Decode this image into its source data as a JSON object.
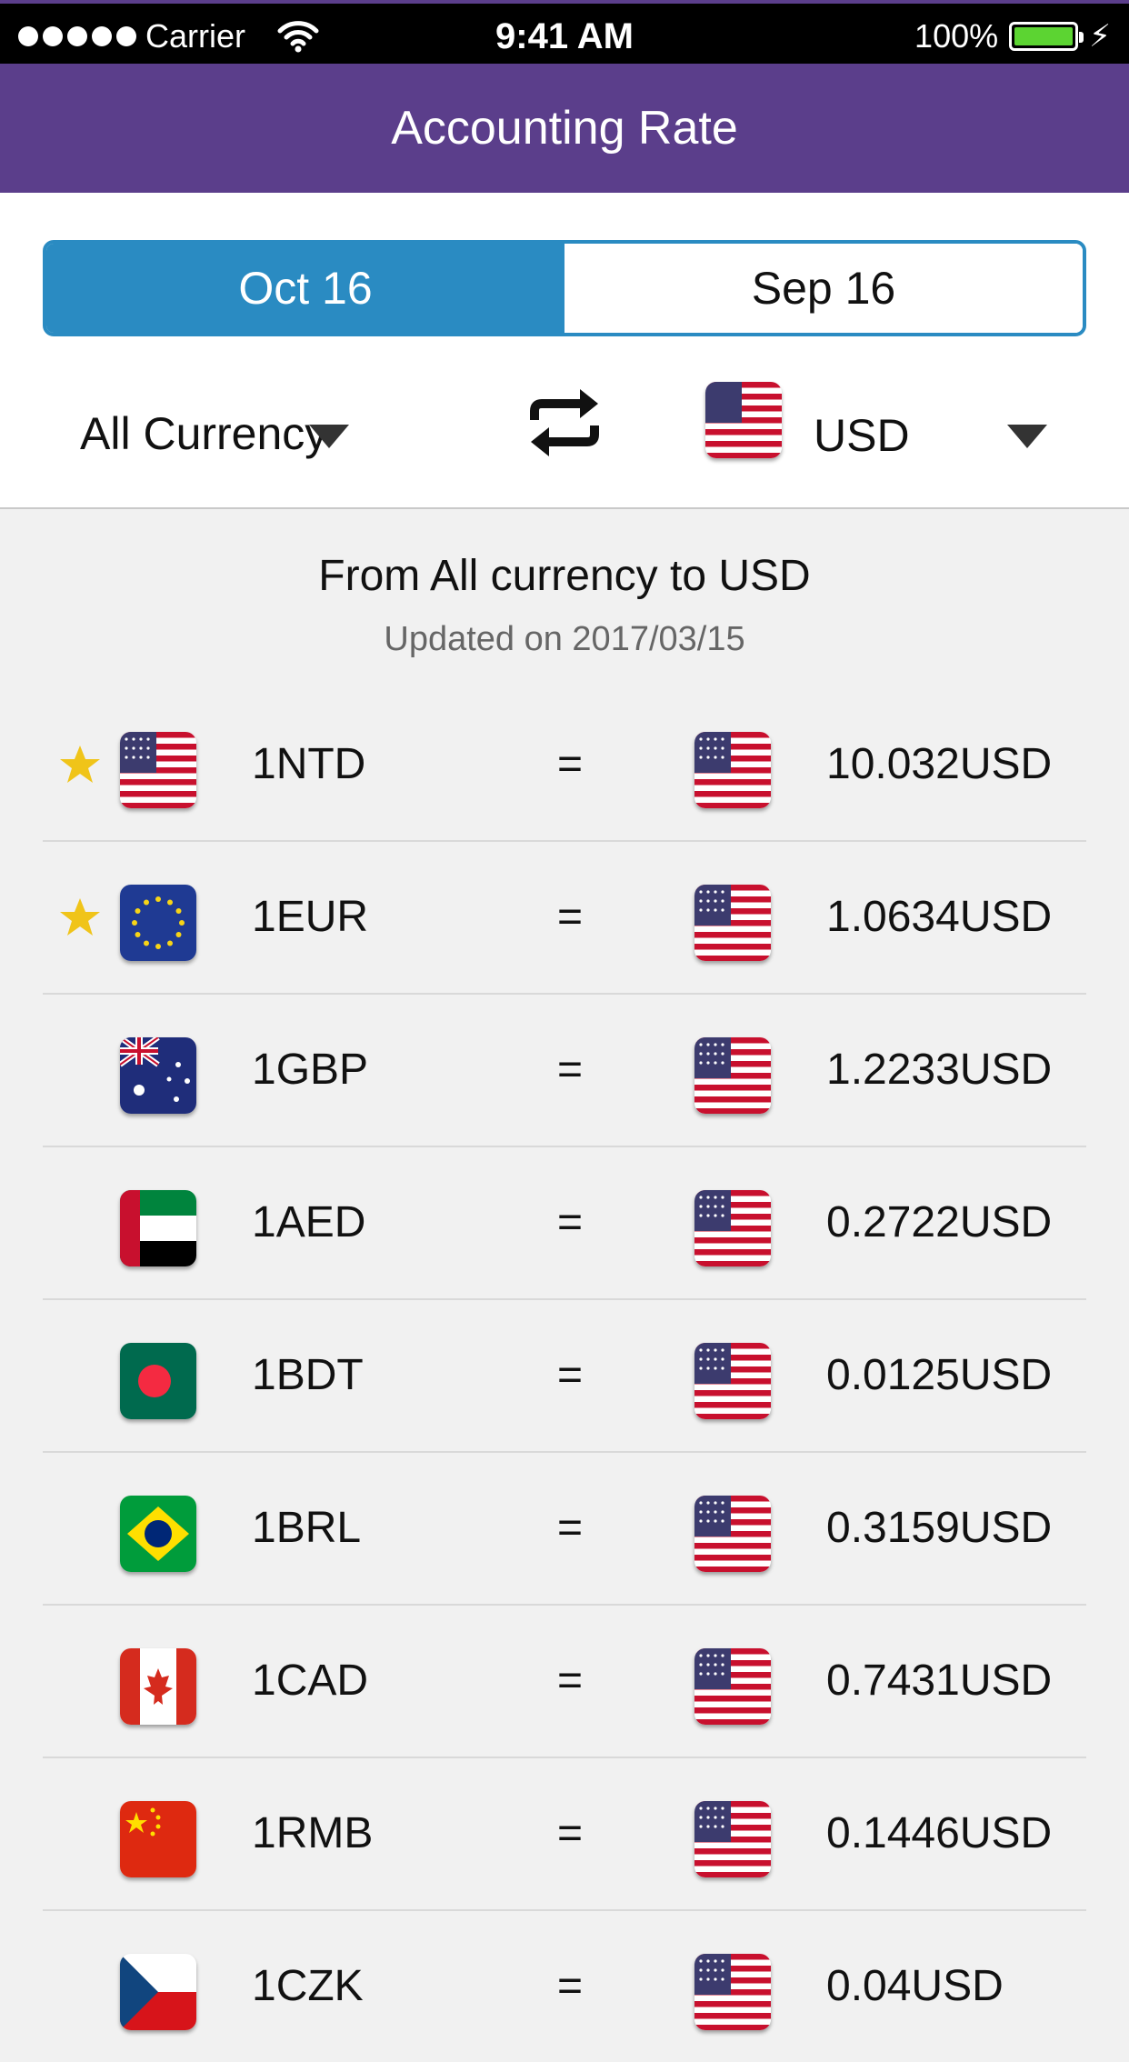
{
  "status_bar": {
    "carrier": "Carrier",
    "time": "9:41 AM",
    "battery": "100%"
  },
  "header": {
    "title": "Accounting Rate"
  },
  "tabs": {
    "active": "Oct 16",
    "inactive": "Sep 16"
  },
  "selectors": {
    "from_currency": "All Currency",
    "to_currency": "USD",
    "to_flag": "us"
  },
  "summary": {
    "title": "From All currency to USD",
    "updated": "Updated on 2017/03/15"
  },
  "colors": {
    "header": "#5b3e8b",
    "tab_active": "#2a8bc2",
    "star": "#f0c419"
  },
  "rates": [
    {
      "starred": true,
      "flag": "us",
      "from": "1NTD",
      "eq": "=",
      "to_flag": "us",
      "to": "10.032USD"
    },
    {
      "starred": true,
      "flag": "eu",
      "from": "1EUR",
      "eq": "=",
      "to_flag": "us",
      "to": "1.0634USD"
    },
    {
      "starred": false,
      "flag": "au",
      "from": "1GBP",
      "eq": "=",
      "to_flag": "us",
      "to": "1.2233USD"
    },
    {
      "starred": false,
      "flag": "ae",
      "from": "1AED",
      "eq": "=",
      "to_flag": "us",
      "to": "0.2722USD"
    },
    {
      "starred": false,
      "flag": "bd",
      "from": "1BDT",
      "eq": "=",
      "to_flag": "us",
      "to": "0.0125USD"
    },
    {
      "starred": false,
      "flag": "br",
      "from": "1BRL",
      "eq": "=",
      "to_flag": "us",
      "to": "0.3159USD"
    },
    {
      "starred": false,
      "flag": "ca",
      "from": "1CAD",
      "eq": "=",
      "to_flag": "us",
      "to": "0.7431USD"
    },
    {
      "starred": false,
      "flag": "cn",
      "from": "1RMB",
      "eq": "=",
      "to_flag": "us",
      "to": "0.1446USD"
    },
    {
      "starred": false,
      "flag": "cz",
      "from": "1CZK",
      "eq": "=",
      "to_flag": "us",
      "to": "0.04USD"
    }
  ]
}
